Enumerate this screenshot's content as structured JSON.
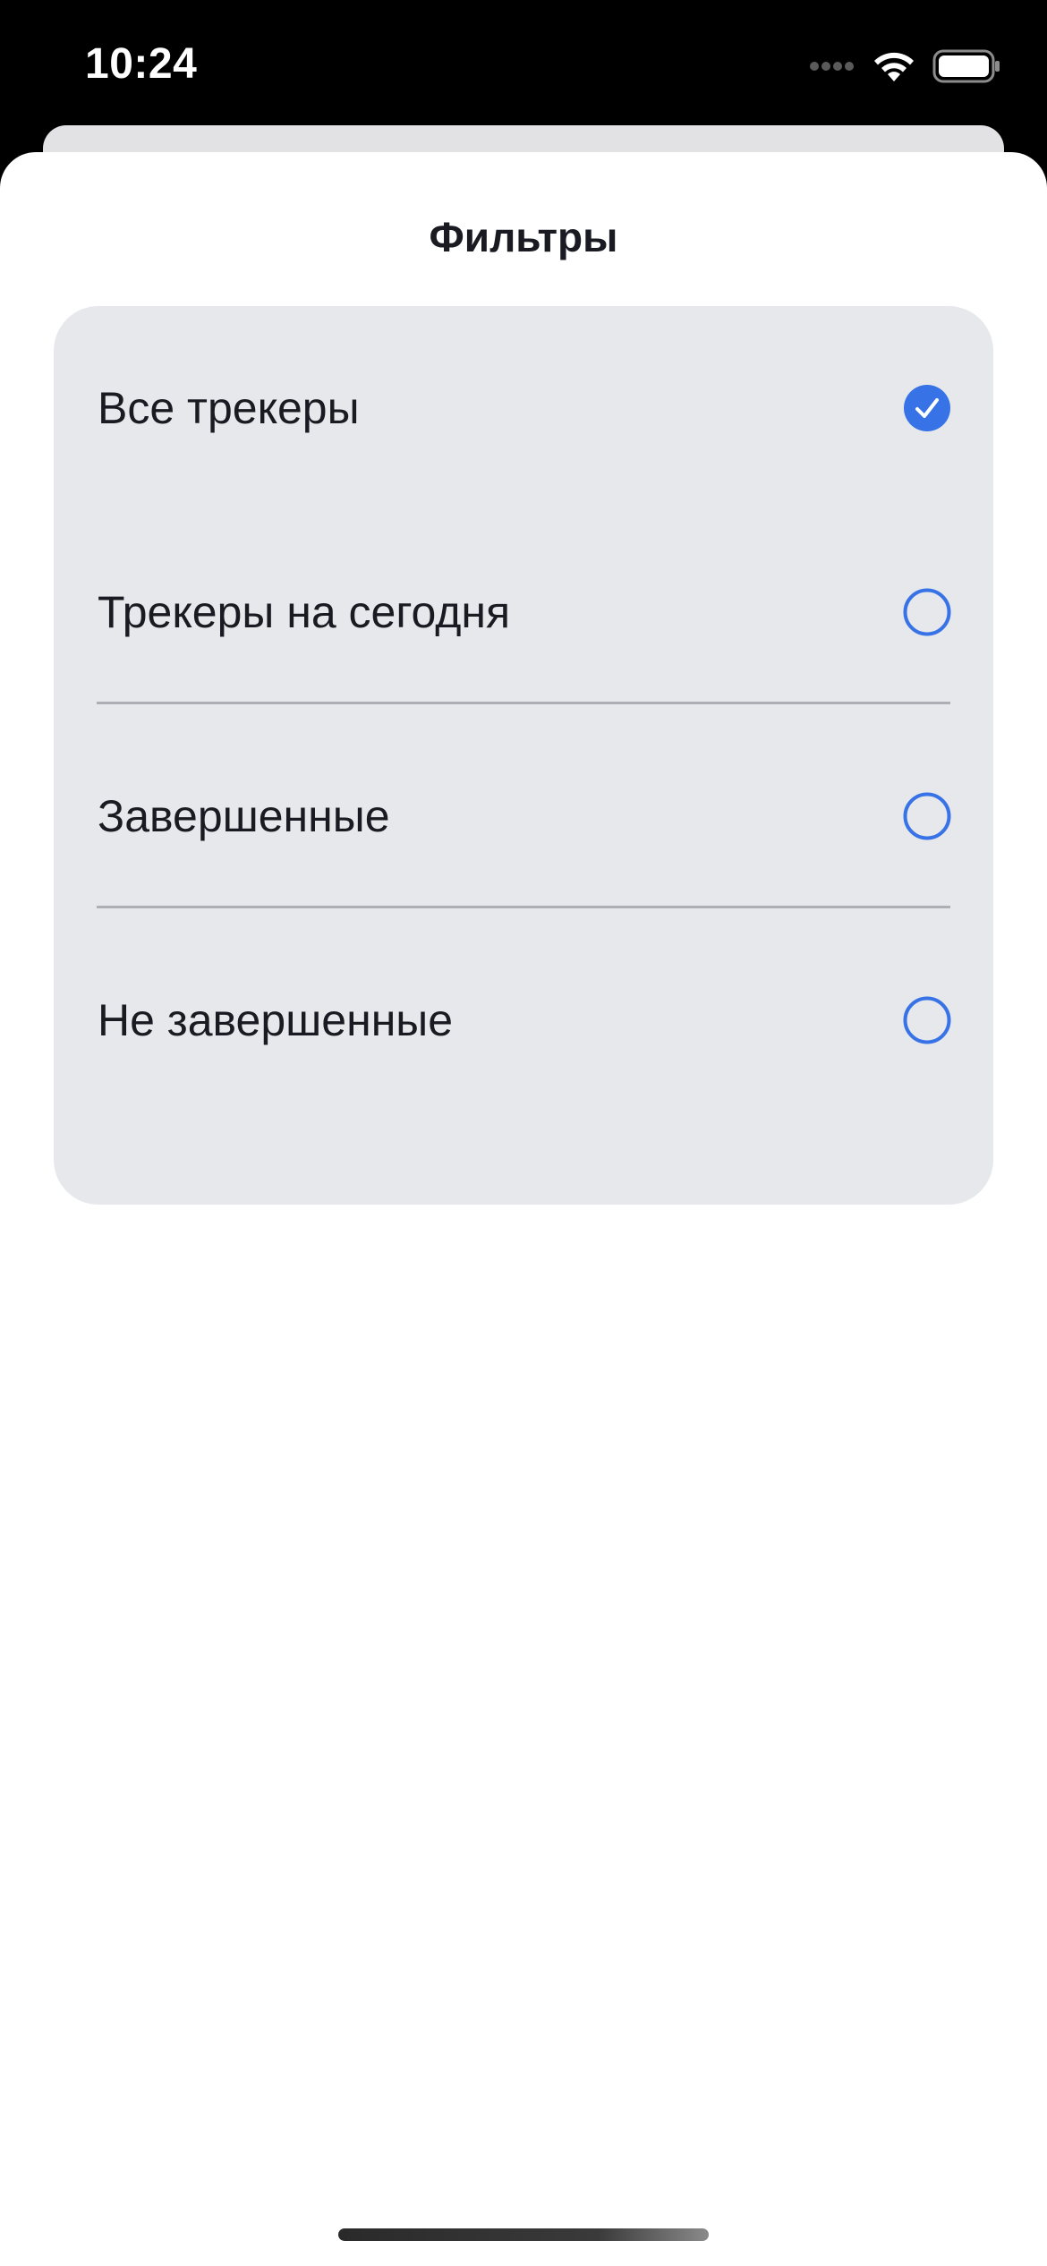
{
  "status_bar": {
    "time": "10:24",
    "icons": [
      "cellular-dots-icon",
      "wifi-icon",
      "battery-icon"
    ]
  },
  "sheet": {
    "title": "Фильтры"
  },
  "filters": [
    {
      "label": "Все трекеры",
      "selected": true
    },
    {
      "label": "Трекеры на сегодня",
      "selected": false
    },
    {
      "label": "Завершенные",
      "selected": false
    },
    {
      "label": "Не завершенные",
      "selected": false
    }
  ],
  "colors": {
    "accent": "#3772e7",
    "card_background": "#e6e8eb",
    "text": "#1a1b22",
    "divider": "#aeafb4"
  }
}
